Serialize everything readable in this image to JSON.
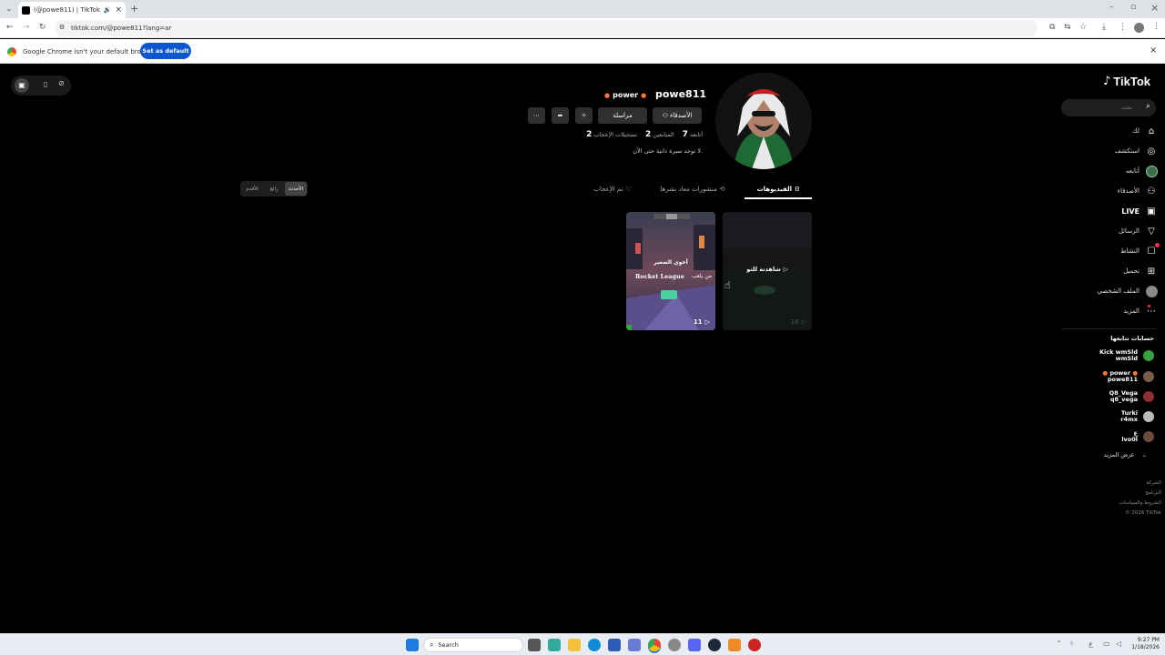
{
  "browser": {
    "tab_title": "(@powe811) | TikTok",
    "tab_close": "×",
    "new_tab": "+",
    "url": "tiktok.com/@powe811?lang=ar",
    "infobar_text": "Google Chrome isn't your default browser",
    "set_default_label": "Set as default",
    "infobar_close": "×",
    "window_controls": [
      "–",
      "▫",
      "×"
    ]
  },
  "sidebar": {
    "logo": "TikTok",
    "search_placeholder": "بحث",
    "nav": [
      {
        "label": "لك",
        "icon": "home-icon"
      },
      {
        "label": "استكشف",
        "icon": "compass-icon"
      },
      {
        "label": "أتابعه",
        "icon": "following-avatar-icon"
      },
      {
        "label": "الأصدقاء",
        "icon": "friends-icon"
      },
      {
        "label": "LIVE",
        "icon": "live-icon"
      },
      {
        "label": "الرسائل",
        "icon": "messages-icon"
      },
      {
        "label": "النشاط",
        "icon": "activity-icon"
      },
      {
        "label": "تحميل",
        "icon": "upload-icon"
      },
      {
        "label": "الملف الشخصي",
        "icon": "profile-avatar-icon"
      },
      {
        "label": "المزيد",
        "icon": "more-icon"
      }
    ],
    "following_title": "حسابات تتابعها",
    "following": [
      {
        "name": "Kick wmSld",
        "handle": "wmSld",
        "color": "#3aa142"
      },
      {
        "name": "power",
        "handle": "powe811",
        "color": "#7a5a4a"
      },
      {
        "name": "Q8_Vega",
        "handle": "q8_vega",
        "color": "#8a3030"
      },
      {
        "name": "Turki",
        "handle": "r4mx",
        "color": "#bbbbbb"
      },
      {
        "name": "ع",
        "handle": "lvo0l",
        "color": "#6b4c3b"
      }
    ],
    "see_more": "عرض المزيد",
    "footer": [
      "الشركة",
      "البرنامج",
      "الشروط والسياسات",
      "© 2026 TikTok"
    ]
  },
  "profile": {
    "username": "powe811",
    "nickname": "power",
    "follow_label": "الأصدقاء",
    "message_label": "مراسلة",
    "following_count": "7",
    "following_label": "أتابعه",
    "followers_count": "2",
    "followers_label": "المتابعين",
    "likes_count": "2",
    "likes_label": "تسجيلات الإعجاب",
    "bio": "لا توجد سيرة ذاتية حتى الآن."
  },
  "tabs": [
    {
      "label": "الفيديوهات",
      "icon": "grid-icon",
      "active": true
    },
    {
      "label": "منشورات معاد نشرها",
      "icon": "repost-icon",
      "active": false
    },
    {
      "label": "تم الإعجاب",
      "icon": "heart-off-icon",
      "active": false
    }
  ],
  "sort": [
    "الأحدث",
    "رائج",
    "الأقدم"
  ],
  "videos": [
    {
      "overlay": "شاهدته للتو",
      "views": "18",
      "dim": true
    },
    {
      "caption_top": "أخوي الصغير",
      "caption_mid": "Rocket League",
      "caption_side": "من يلعب",
      "views": "11",
      "dim": false
    }
  ],
  "taskbar": {
    "search_label": "Search",
    "time": "9:27 PM",
    "date": "1/18/2026"
  }
}
